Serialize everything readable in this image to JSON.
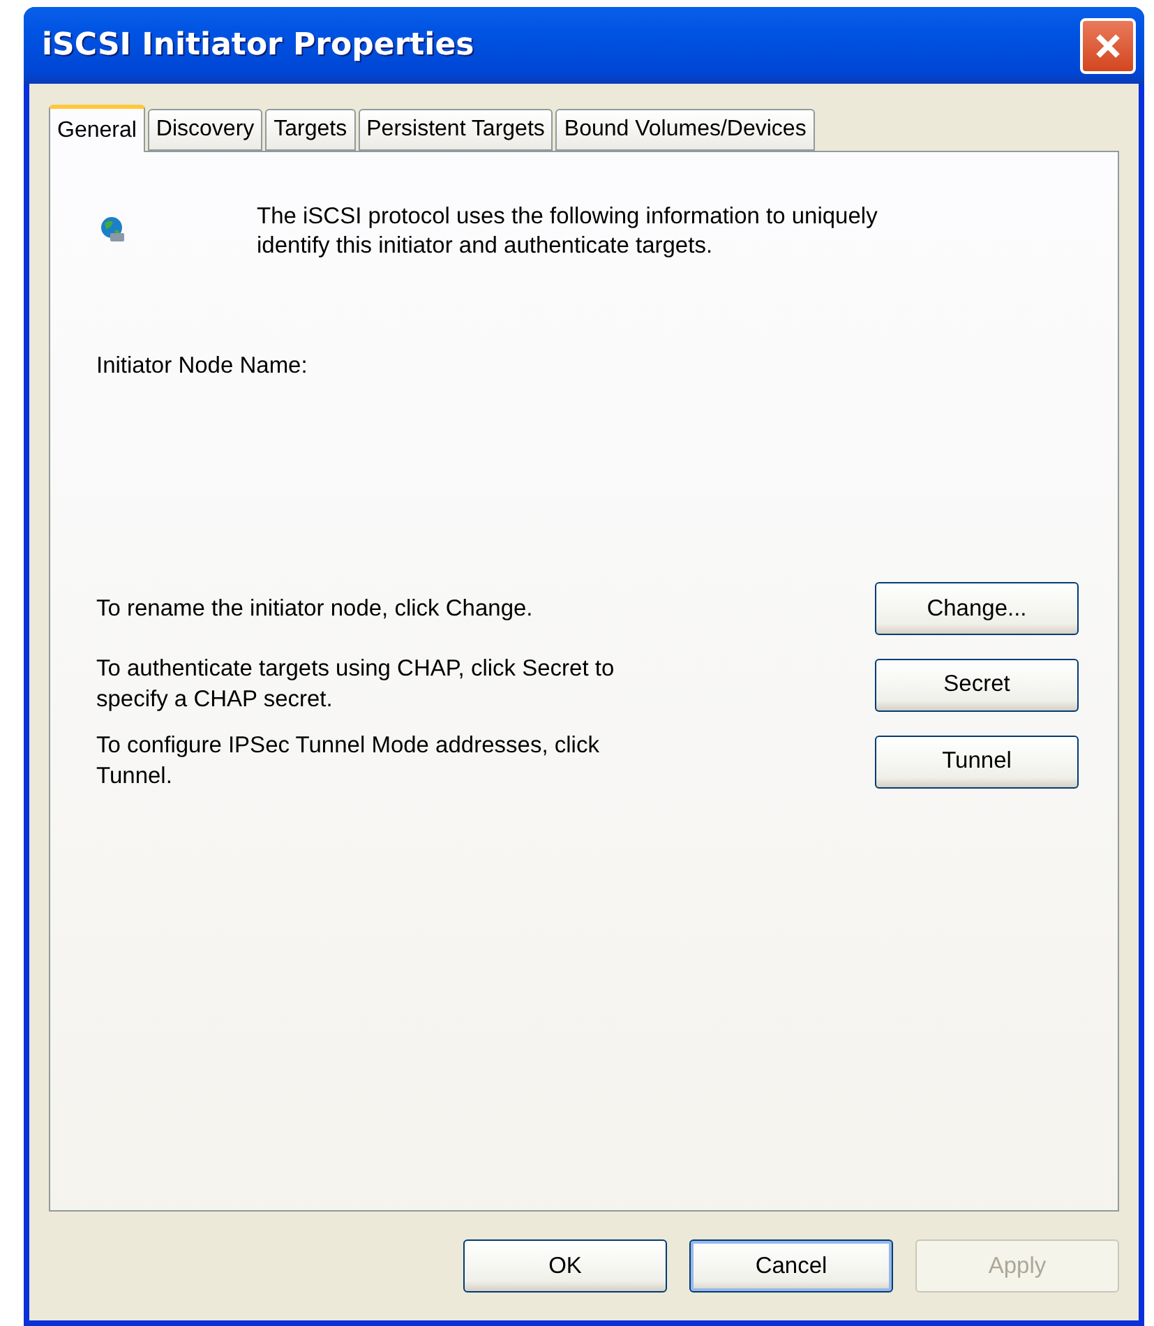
{
  "window": {
    "title": "iSCSI Initiator Properties"
  },
  "tabs": [
    {
      "label": "General",
      "selected": true
    },
    {
      "label": "Discovery",
      "selected": false
    },
    {
      "label": "Targets",
      "selected": false
    },
    {
      "label": "Persistent Targets",
      "selected": false
    },
    {
      "label": "Bound Volumes/Devices",
      "selected": false
    }
  ],
  "intro": "The iSCSI protocol uses the following information to uniquely identify this initiator and authenticate targets.",
  "node_name_label": "Initiator Node Name:",
  "actions": [
    {
      "text": "To rename the initiator node, click Change.",
      "button": "Change..."
    },
    {
      "text": "To authenticate targets using CHAP, click Secret to specify a CHAP secret.",
      "button": "Secret"
    },
    {
      "text": "To configure IPSec Tunnel Mode addresses, click Tunnel.",
      "button": "Tunnel"
    }
  ],
  "buttons": [
    {
      "label": "OK",
      "focused": false,
      "disabled": false
    },
    {
      "label": "Cancel",
      "focused": true,
      "disabled": false
    },
    {
      "label": "Apply",
      "focused": false,
      "disabled": true
    }
  ]
}
